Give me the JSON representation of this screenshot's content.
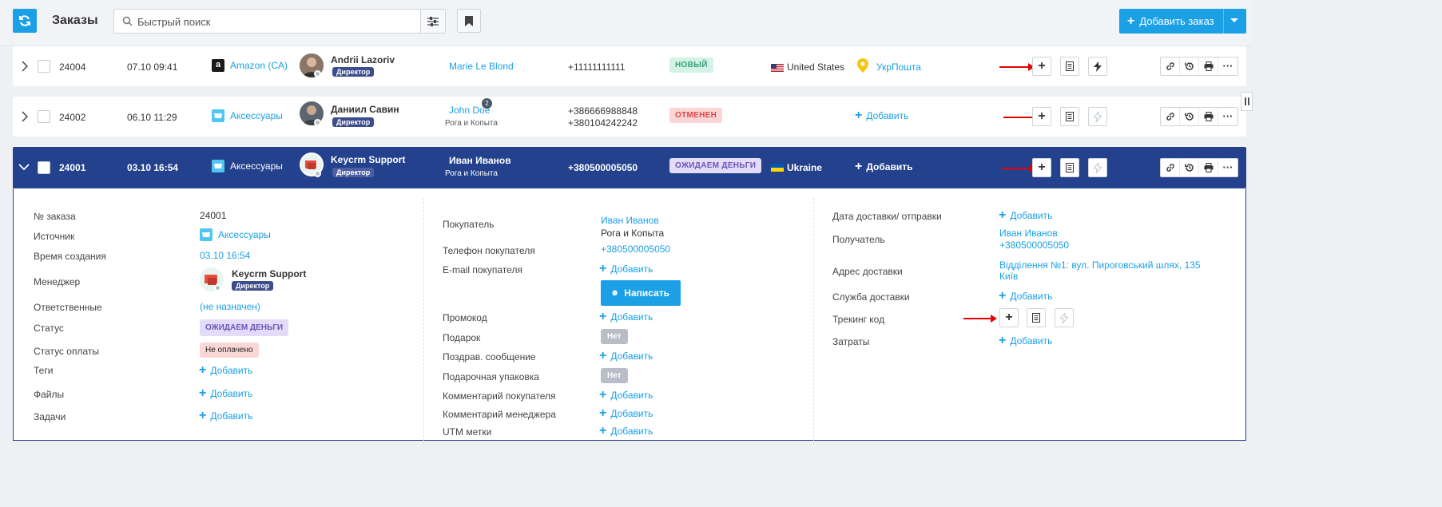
{
  "header": {
    "title": "Заказы",
    "search_placeholder": "Быстрый поиск",
    "add_order_label": "Добавить заказ"
  },
  "orders": [
    {
      "id": "24004",
      "date": "07.10 09:41",
      "source": "Amazon (CA)",
      "manager": "Andrii Lazoriv",
      "role": "Директор",
      "buyer": "Marie Le Blond",
      "phone": "+11111111111",
      "status": "НОВЫЙ",
      "country": "United States",
      "delivery": "УкрПошта"
    },
    {
      "id": "24002",
      "date": "06.10 11:29",
      "source": "Аксессуары",
      "manager": "Даниил Савин",
      "role": "Директор",
      "buyer": "John Doe",
      "buyer_count": "2",
      "buyer_company": "Рога и Копыта",
      "phone1": "+386666988848",
      "phone2": "+380104242242",
      "status": "ОТМЕНЕН",
      "delivery_add": "Добавить"
    },
    {
      "id": "24001",
      "date": "03.10 16:54",
      "source": "Аксессуары",
      "manager": "Keycrm Support",
      "role": "Директор",
      "buyer": "Иван Иванов",
      "buyer_company": "Рога и Копыта",
      "phone": "+380500005050",
      "status": "ОЖИДАЕМ ДЕНЬГИ",
      "country": "Ukraine",
      "delivery_add": "Добавить"
    }
  ],
  "details": {
    "col1": {
      "order_no_label": "№ заказа",
      "order_no": "24001",
      "source_label": "Источник",
      "source": "Аксессуары",
      "created_label": "Время создания",
      "created": "03.10 16:54",
      "manager_label": "Менеджер",
      "manager": "Keycrm Support",
      "manager_role": "Директор",
      "responsible_label": "Ответственные",
      "responsible": "(не назначен)",
      "status_label": "Статус",
      "status": "ОЖИДАЕМ ДЕНЬГИ",
      "payment_label": "Статус оплаты",
      "payment": "Не оплачено",
      "tags_label": "Теги",
      "files_label": "Файлы",
      "tasks_label": "Задачи",
      "add": "Добавить"
    },
    "col2": {
      "buyer_label": "Покупатель",
      "buyer": "Иван Иванов",
      "buyer_company": "Рога и Копыта",
      "phone_label": "Телефон покупателя",
      "phone": "+380500005050",
      "email_label": "E-mail покупателя",
      "write_label": "Написать",
      "promo_label": "Промокод",
      "gift_label": "Подарок",
      "gift": "Нет",
      "greeting_label": "Поздрав. сообщение",
      "wrap_label": "Подарочная упаковка",
      "wrap": "Нет",
      "buyer_comment_label": "Комментарий покупателя",
      "manager_comment_label": "Комментарий менеджера",
      "utm_label": "UTM метки",
      "add": "Добавить"
    },
    "col3": {
      "delivery_date_label": "Дата доставки/ отправки",
      "recipient_label": "Получатель",
      "recipient_name": "Иван Иванов",
      "recipient_phone": "+380500005050",
      "address_label": "Адрес доставки",
      "address_line1": "Відділення №1: вул. Пироговський шлях, 135",
      "address_line2": "Київ",
      "service_label": "Служба доставки",
      "tracking_label": "Трекинг код",
      "costs_label": "Затраты",
      "add": "Добавить"
    }
  },
  "colors": {
    "accent": "#1ba0e6",
    "selected_row": "#23418c",
    "annotation_arrow": "#e60000"
  }
}
